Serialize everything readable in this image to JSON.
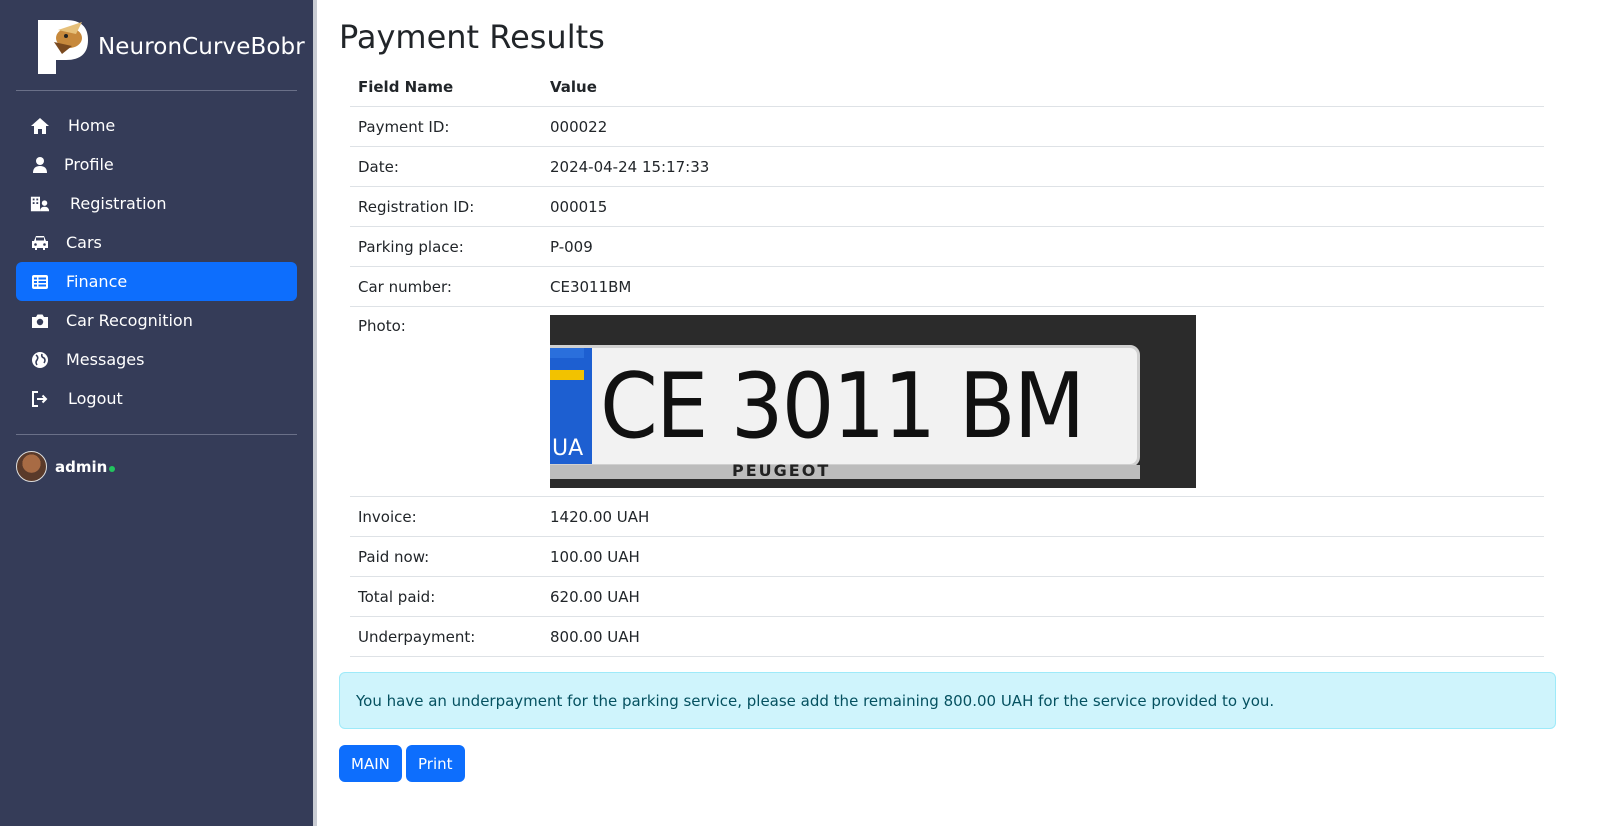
{
  "brand": {
    "name": "NeuronCurveBobr",
    "logo_icon": "parking-logo-icon"
  },
  "sidebar": {
    "items": [
      {
        "label": "Home",
        "icon": "home-icon",
        "active": false
      },
      {
        "label": "Profile",
        "icon": "user-icon",
        "active": false
      },
      {
        "label": "Registration",
        "icon": "building-user-icon",
        "active": false
      },
      {
        "label": "Cars",
        "icon": "car-icon",
        "active": false
      },
      {
        "label": "Finance",
        "icon": "table-list-icon",
        "active": true
      },
      {
        "label": "Car Recognition",
        "icon": "camera-icon",
        "active": false
      },
      {
        "label": "Messages",
        "icon": "globe-icon",
        "active": false
      },
      {
        "label": "Logout",
        "icon": "sign-out-icon",
        "active": false
      }
    ],
    "user": {
      "name": "admin",
      "status": "online"
    },
    "colors": {
      "background": "#353c58",
      "active": "#0d6efd"
    }
  },
  "main": {
    "title": "Payment Results",
    "table": {
      "headers": [
        "Field Name",
        "Value"
      ],
      "rows": [
        {
          "field": "Payment ID:",
          "value": "000022"
        },
        {
          "field": "Date:",
          "value": "2024-04-24 15:17:33"
        },
        {
          "field": "Registration ID:",
          "value": "000015"
        },
        {
          "field": "Parking place:",
          "value": "P-009"
        },
        {
          "field": "Car number:",
          "value": "CE3011BM"
        },
        {
          "field": "Photo:",
          "value": ""
        },
        {
          "field": "Invoice:",
          "value": "1420.00 UAH"
        },
        {
          "field": "Paid now:",
          "value": "100.00 UAH"
        },
        {
          "field": "Total paid:",
          "value": "620.00 UAH"
        },
        {
          "field": "Underpayment:",
          "value": "800.00 UAH"
        }
      ]
    },
    "photo": {
      "plate_text": "CE 3011 BM",
      "country_code": "UA",
      "frame_brand": "PEUGEOT"
    },
    "alert": "You have an underpayment for the parking service, please add the remaining 800.00 UAH for the service provided to you.",
    "buttons": {
      "main": "MAIN",
      "print": "Print"
    }
  }
}
